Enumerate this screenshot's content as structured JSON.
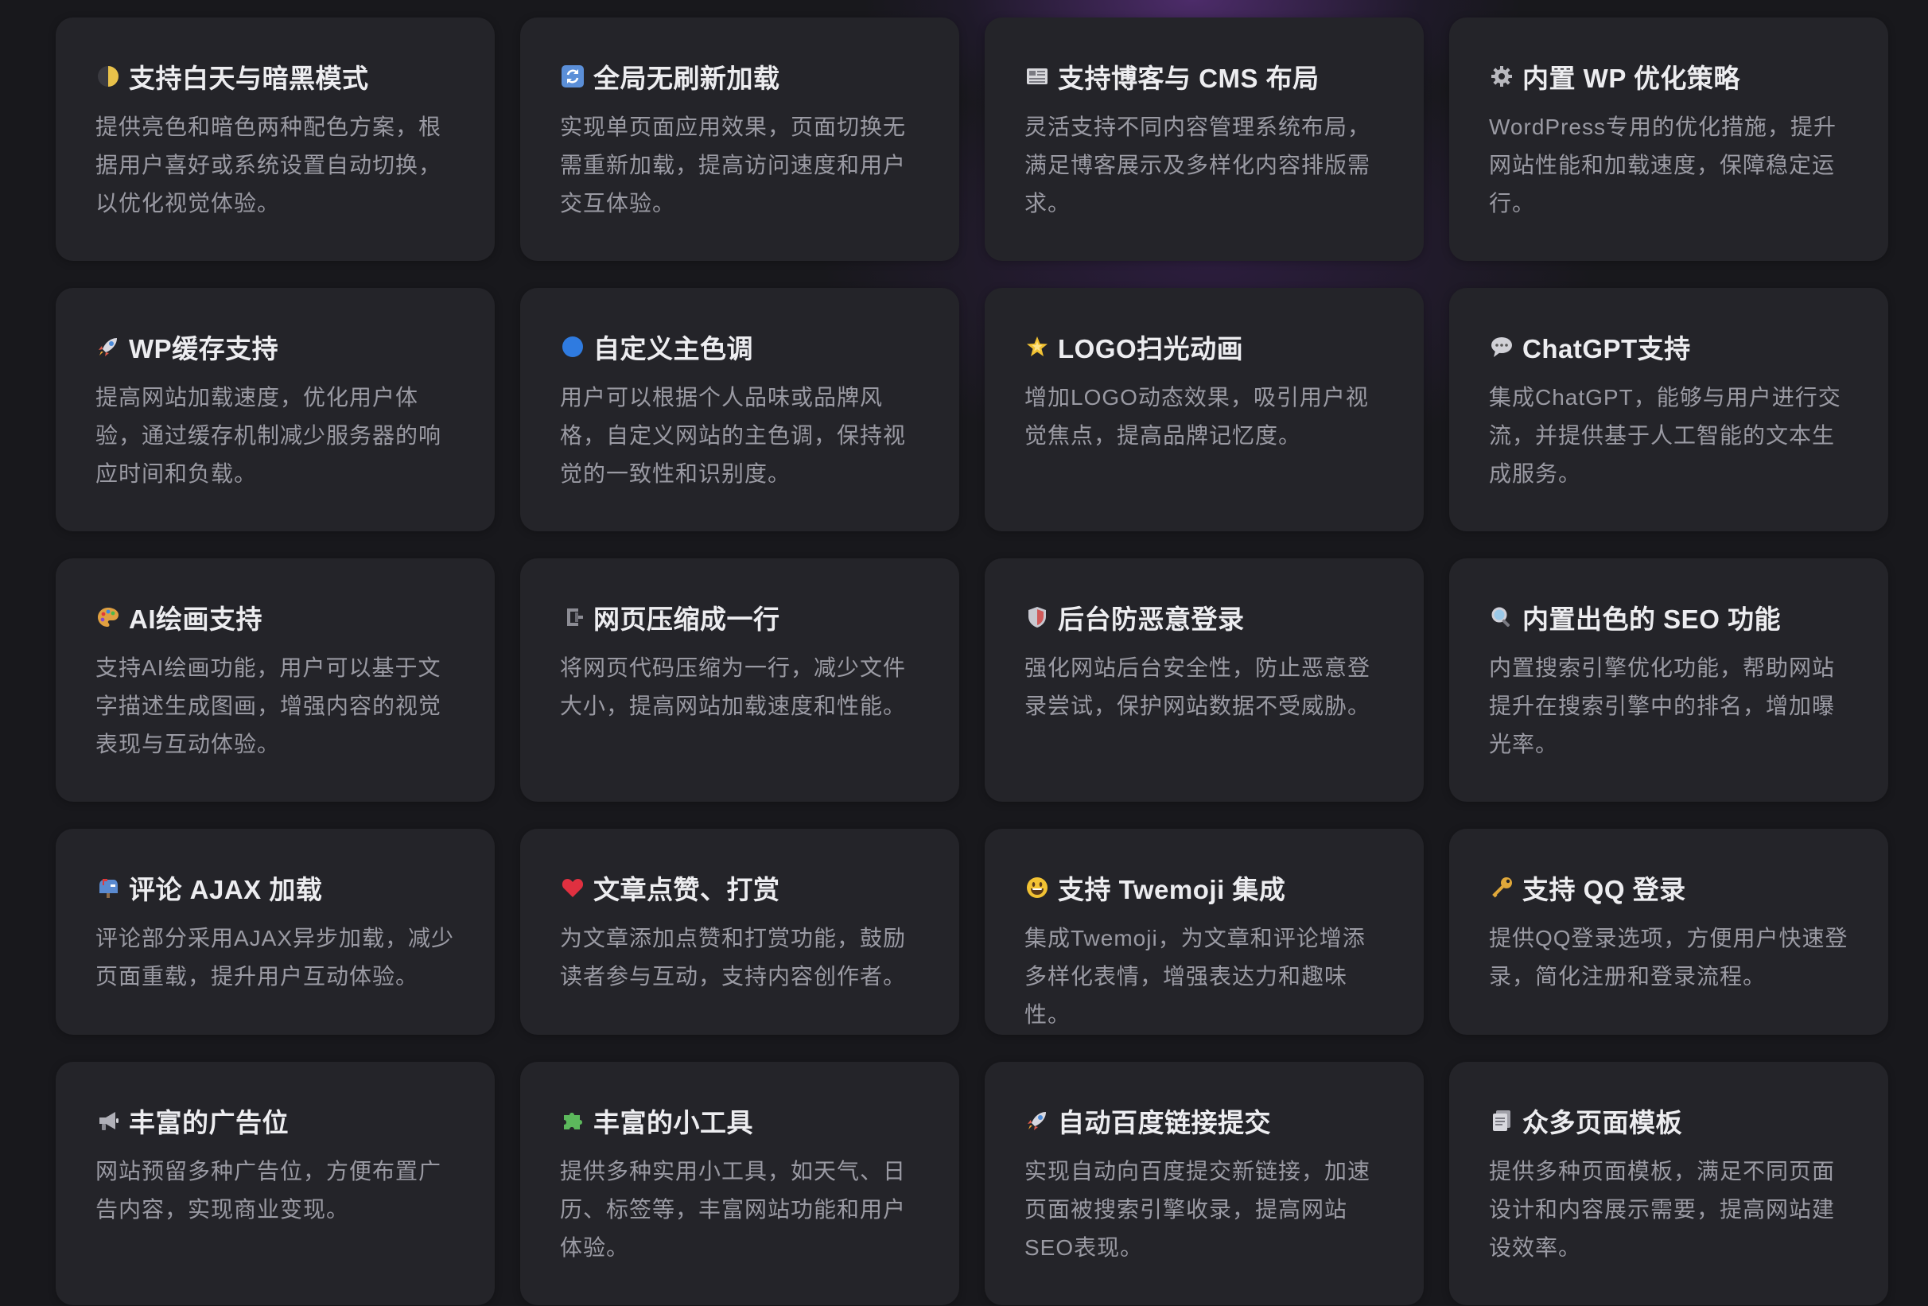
{
  "features": [
    {
      "icon": "half-moon-icon",
      "glyph": "🌓",
      "color": "#e8c14a",
      "title": "支持白天与暗黑模式",
      "desc": "提供亮色和暗色两种配色方案，根据用户喜好或系统设置自动切换，以优化视觉体验。"
    },
    {
      "icon": "refresh-icon",
      "glyph": "🔄",
      "color": "#5b8fd8",
      "title": "全局无刷新加载",
      "desc": "实现单页面应用效果，页面切换无需重新加载，提高访问速度和用户交互体验。"
    },
    {
      "icon": "newspaper-icon",
      "glyph": "📰",
      "color": "#c8c8cc",
      "title": "支持博客与 CMS 布局",
      "desc": "灵活支持不同内容管理系统布局，满足博客展示及多样化内容排版需求。"
    },
    {
      "icon": "gear-icon",
      "glyph": "⚙",
      "color": "#b8b8be",
      "title": "内置 WP 优化策略",
      "desc": "WordPress专用的优化措施，提升网站性能和加载速度，保障稳定运行。"
    },
    {
      "icon": "rocket-icon",
      "glyph": "🚀",
      "color": "#e05a4a",
      "title": "WP缓存支持",
      "desc": "提高网站加载速度，优化用户体验，通过缓存机制减少服务器的响应时间和负载。"
    },
    {
      "icon": "blue-circle-icon",
      "glyph": "●",
      "color": "#2f7be0",
      "title": "自定义主色调",
      "desc": "用户可以根据个人品味或品牌风格，自定义网站的主色调，保持视觉的一致性和识别度。"
    },
    {
      "icon": "glowing-star-icon",
      "glyph": "★",
      "color": "#f2c233",
      "title": "LOGO扫光动画",
      "desc": "增加LOGO动态效果，吸引用户视觉焦点，提高品牌记忆度。"
    },
    {
      "icon": "speech-bubble-icon",
      "glyph": "💬",
      "color": "#d0d0d6",
      "title": "ChatGPT支持",
      "desc": "集成ChatGPT，能够与用户进行交流，并提供基于人工智能的文本生成服务。"
    },
    {
      "icon": "palette-icon",
      "glyph": "🎨",
      "color": "#e0a040",
      "title": "AI绘画支持",
      "desc": "支持AI绘画功能，用户可以基于文字描述生成图画，增强内容的视觉表现与互动体验。"
    },
    {
      "icon": "clamp-icon",
      "glyph": "🗜",
      "color": "#8c8c94",
      "title": "网页压缩成一行",
      "desc": "将网页代码压缩为一行，减少文件大小，提高网站加载速度和性能。"
    },
    {
      "icon": "shield-icon",
      "glyph": "🛡",
      "color": "#d06060",
      "title": "后台防恶意登录",
      "desc": "强化网站后台安全性，防止恶意登录尝试，保护网站数据不受威胁。"
    },
    {
      "icon": "magnifier-icon",
      "glyph": "🔍",
      "color": "#c8c8d0",
      "title": "内置出色的 SEO 功能",
      "desc": "内置搜索引擎优化功能，帮助网站提升在搜索引擎中的排名，增加曝光率。"
    },
    {
      "icon": "mailbox-icon",
      "glyph": "📫",
      "color": "#5a8ad0",
      "title": "评论 AJAX 加载",
      "desc": "评论部分采用AJAX异步加载，减少页面重载，提升用户互动体验。"
    },
    {
      "icon": "heart-icon",
      "glyph": "❤",
      "color": "#e03040",
      "title": "文章点赞、打赏",
      "desc": "为文章添加点赞和打赏功能，鼓励读者参与互动，支持内容创作者。"
    },
    {
      "icon": "smiley-icon",
      "glyph": "😃",
      "color": "#f2c233",
      "title": "支持 Twemoji 集成",
      "desc": "集成Twemoji，为文章和评论增添多样化表情，增强表达力和趣味性。"
    },
    {
      "icon": "key-icon",
      "glyph": "🔑",
      "color": "#e0a83a",
      "title": "支持 QQ 登录",
      "desc": "提供QQ登录选项，方便用户快速登录，简化注册和登录流程。"
    },
    {
      "icon": "megaphone-icon",
      "glyph": "📢",
      "color": "#b0b0b8",
      "title": "丰富的广告位",
      "desc": "网站预留多种广告位，方便布置广告内容，实现商业变现。"
    },
    {
      "icon": "puzzle-icon",
      "glyph": "🧩",
      "color": "#5cb85c",
      "title": "丰富的小工具",
      "desc": "提供多种实用小工具，如天气、日历、标签等，丰富网站功能和用户体验。"
    },
    {
      "icon": "rocket-icon",
      "glyph": "🚀",
      "color": "#e05a4a",
      "title": "自动百度链接提交",
      "desc": "实现自动向百度提交新链接，加速页面被搜索引擎收录，提高网站SEO表现。"
    },
    {
      "icon": "page-icon",
      "glyph": "📑",
      "color": "#c8c8d0",
      "title": "众多页面模板",
      "desc": "提供多种页面模板，满足不同页面设计和内容展示需要，提高网站建设效率。"
    }
  ]
}
